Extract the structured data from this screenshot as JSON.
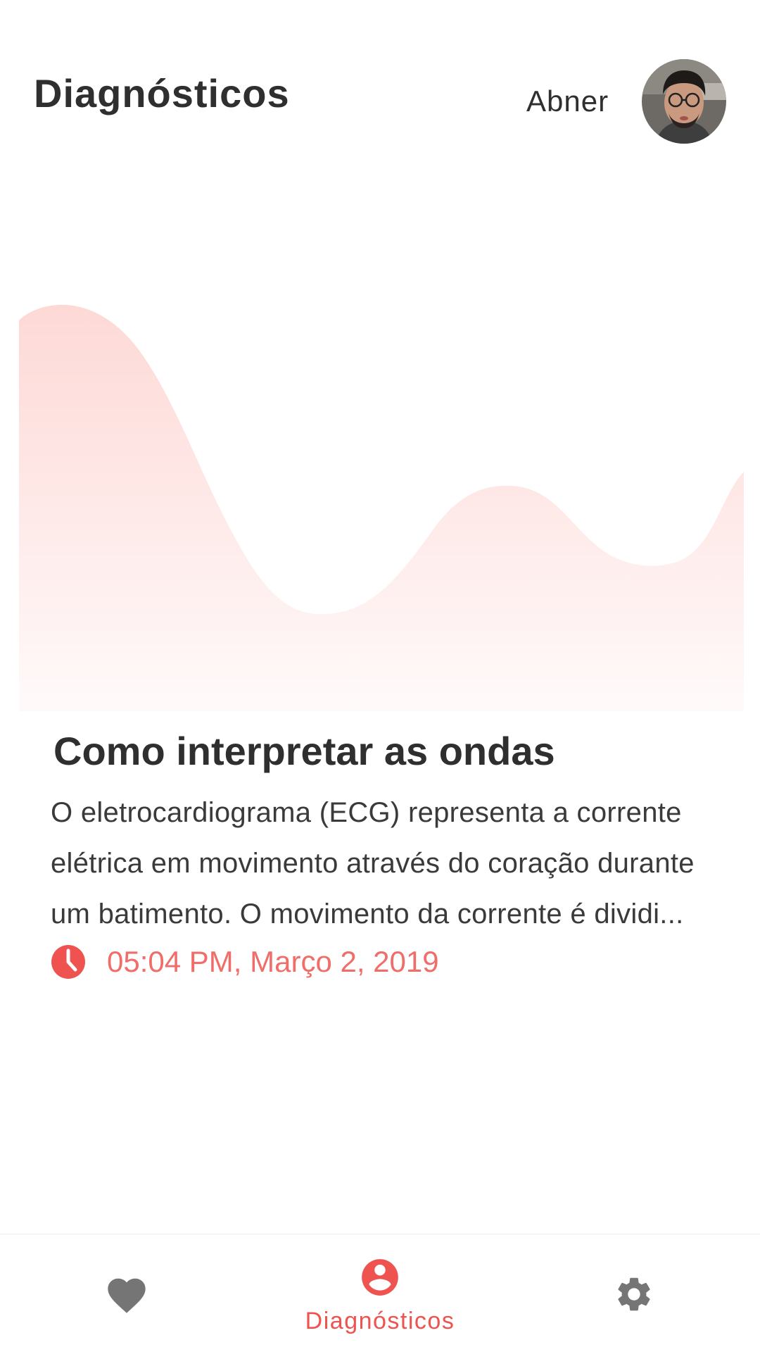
{
  "header": {
    "title": "Diagnósticos",
    "user_name": "Abner",
    "avatar_icon": "user-avatar-photo"
  },
  "card": {
    "title": "Como interpretar as ondas",
    "body": "O eletrocardiograma (ECG) representa a corrente elétrica em movimento através do coração durante um batimento. O movimento da corrente é dividi...",
    "time_icon": "clock-icon",
    "timestamp": "05:04 PM, Março 2, 2019"
  },
  "bottom_nav": {
    "items": [
      {
        "icon": "heart-icon",
        "label": "",
        "active": false
      },
      {
        "icon": "account-circle-icon",
        "label": "Diagnósticos",
        "active": true
      },
      {
        "icon": "gear-icon",
        "label": "",
        "active": false
      }
    ]
  },
  "colors": {
    "accent": "#ef5350",
    "timestamp": "#ef6e6a",
    "wave_top": "#fdd9d6",
    "wave_bottom": "#fffafa",
    "inactive_icon": "#757575",
    "text_primary": "#2f2f2f"
  }
}
